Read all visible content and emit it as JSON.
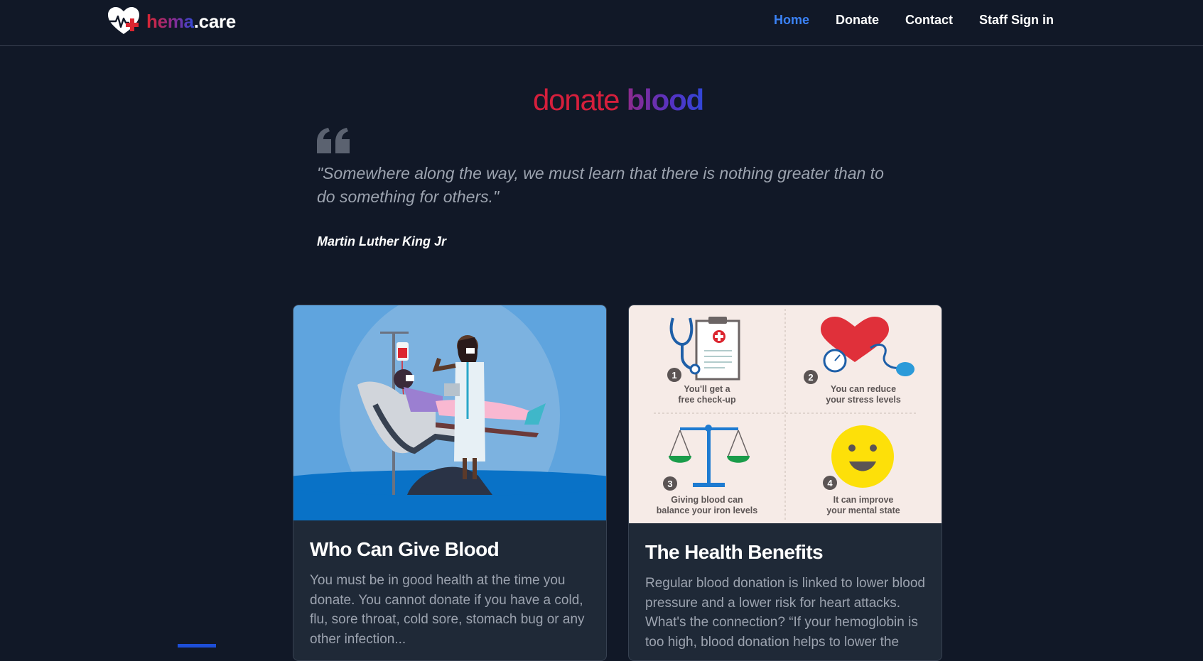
{
  "brand": {
    "name_part1": "hema",
    "name_part2": ".care"
  },
  "nav": {
    "items": [
      {
        "label": "Home",
        "active": true
      },
      {
        "label": "Donate",
        "active": false
      },
      {
        "label": "Contact",
        "active": false
      },
      {
        "label": "Staff Sign in",
        "active": false
      }
    ]
  },
  "hero": {
    "title_part1": "donate",
    "title_part2": "blood",
    "quote": "\"Somewhere along the way, we must learn that there is nothing greater than to do something for others.\"",
    "author": "Martin Luther King Jr"
  },
  "cards": [
    {
      "title": "Who Can Give Blood",
      "text": "You must be in good health at the time you donate. You cannot donate if you have a cold, flu, sore throat, cold sore, stomach bug or any other infection..."
    },
    {
      "title": "The Health Benefits",
      "text": "Regular blood donation is linked to lower blood pressure and a lower risk for heart attacks. What's the connection? “If your hemoglobin is too high, blood donation helps to lower the",
      "benefits": [
        {
          "number": "1",
          "line1": "You'll get a",
          "line2": "free check-up"
        },
        {
          "number": "2",
          "line1": "You can reduce",
          "line2": "your stress levels"
        },
        {
          "number": "3",
          "line1": "Giving blood can",
          "line2": "balance your iron levels"
        },
        {
          "number": "4",
          "line1": "It can improve",
          "line2": "your mental state"
        }
      ]
    }
  ],
  "colors": {
    "background": "#111827",
    "accent_active": "#3b82f6",
    "brand_red": "#dc2630",
    "brand_blue": "#3348d6",
    "card_bg": "#1f2937"
  }
}
